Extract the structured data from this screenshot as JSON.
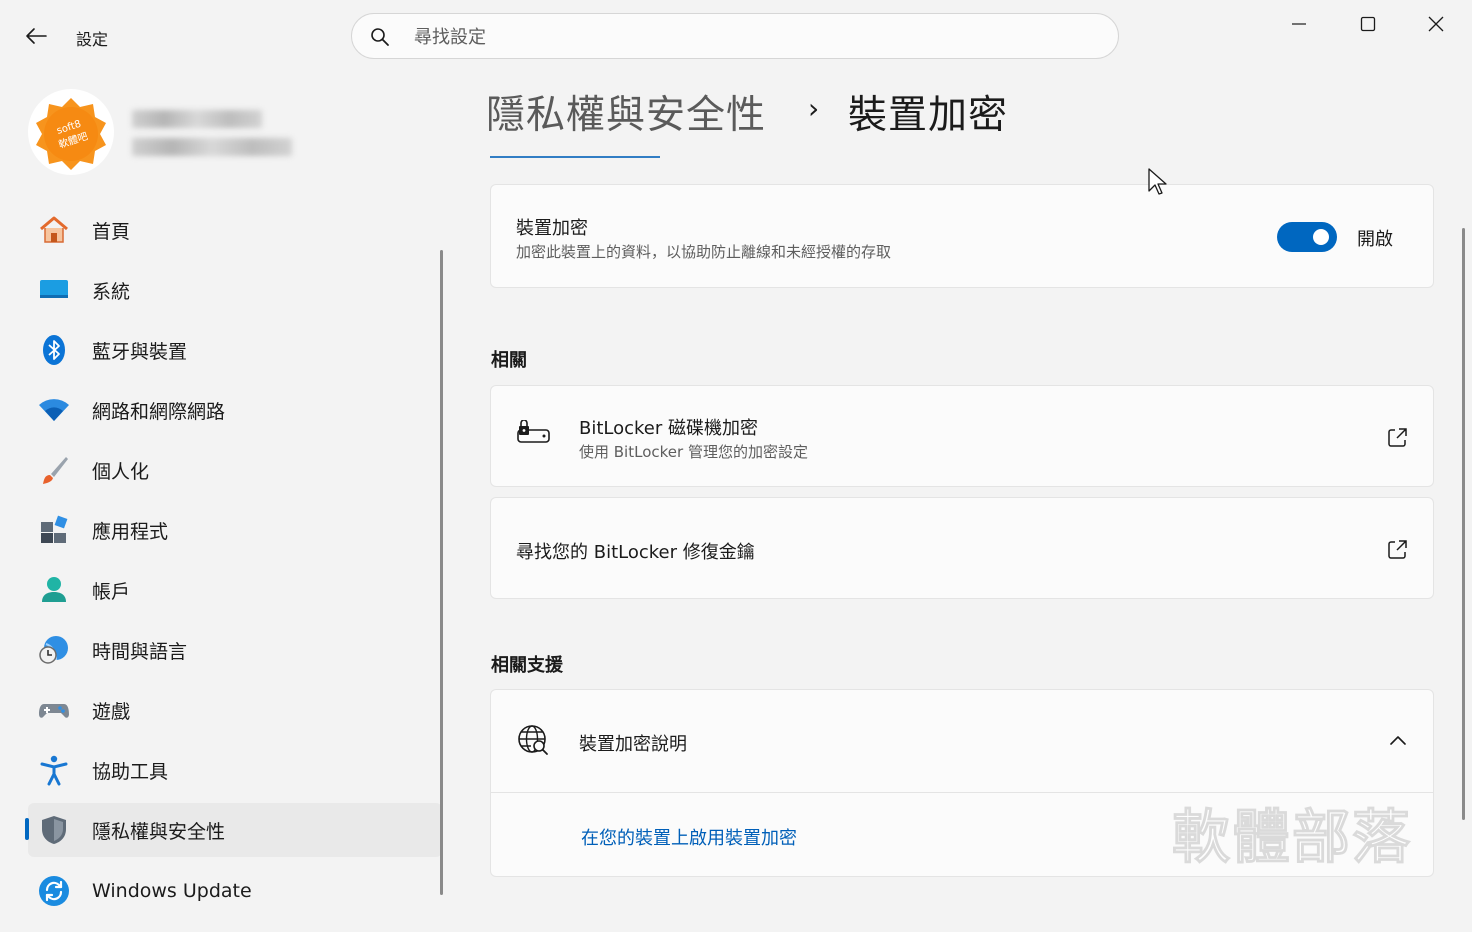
{
  "window": {
    "title": "設定",
    "controls": [
      "minimize",
      "maximize",
      "close"
    ]
  },
  "search": {
    "placeholder": "尋找設定"
  },
  "profile": {
    "avatar_text_top": "soft8",
    "avatar_text_bottom": "軟體吧"
  },
  "sidebar": {
    "items": [
      {
        "label": "首頁",
        "icon": "home-icon"
      },
      {
        "label": "系統",
        "icon": "system-icon"
      },
      {
        "label": "藍牙與裝置",
        "icon": "bluetooth-icon"
      },
      {
        "label": "網路和網際網路",
        "icon": "wifi-icon"
      },
      {
        "label": "個人化",
        "icon": "brush-icon"
      },
      {
        "label": "應用程式",
        "icon": "apps-icon"
      },
      {
        "label": "帳戶",
        "icon": "account-icon"
      },
      {
        "label": "時間與語言",
        "icon": "time-language-icon"
      },
      {
        "label": "遊戲",
        "icon": "gamepad-icon"
      },
      {
        "label": "協助工具",
        "icon": "accessibility-icon"
      },
      {
        "label": "隱私權與安全性",
        "icon": "shield-icon",
        "selected": true
      },
      {
        "label": "Windows Update",
        "icon": "windows-update-icon"
      }
    ]
  },
  "breadcrumb": {
    "parent": "隱私權與安全性",
    "separator": "›",
    "current": "裝置加密"
  },
  "device_encryption": {
    "title": "裝置加密",
    "description": "加密此裝置上的資料，以協助防止離線和未經授權的存取",
    "toggle_state": "開啟",
    "toggle_on": true
  },
  "related": {
    "header": "相關",
    "bitlocker_title": "BitLocker 磁碟機加密",
    "bitlocker_desc": "使用 BitLocker 管理您的加密設定",
    "recovery_key": "尋找您的 BitLocker 修復金鑰"
  },
  "support": {
    "header": "相關支援",
    "help_title": "裝置加密說明",
    "link": "在您的裝置上啟用裝置加密"
  },
  "watermark": "軟體部落",
  "colors": {
    "accent": "#0067c0",
    "link": "#005fb8",
    "background": "#f3f3f3",
    "card": "#fbfbfb"
  }
}
